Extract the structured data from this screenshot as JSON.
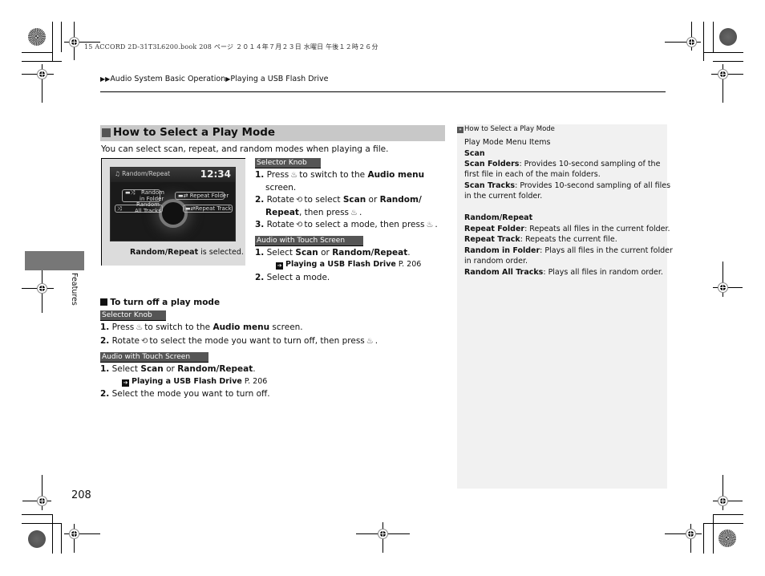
{
  "print_header": "15 ACCORD 2D-31T3L6200.book  208 ページ  ２０１４年７月２３日  水曜日  午後１２時２６分",
  "breadcrumb": {
    "prefix_icon": "double-triangle-right",
    "items": [
      "Audio System Basic Operation",
      "Playing a USB Flash Drive"
    ]
  },
  "section": {
    "title": "How to Select a Play Mode",
    "intro": "You can select scan, repeat, and random modes when playing a file."
  },
  "figure": {
    "screen_title": "Random/Repeat",
    "clock": "12:34",
    "options": [
      "Random in Folder",
      "Repeat Folder",
      "Random All Tracks",
      "Repeat Track"
    ],
    "option_lines": {
      "random_in_folder_1": "Random",
      "random_in_folder_2": "in Folder",
      "repeat_folder": "Repeat Folder",
      "random_all_1": "Random",
      "random_all_2": "All Tracks",
      "repeat_track": "Repeat Track"
    },
    "caption_bold": "Random/Repeat",
    "caption_rest": " is selected."
  },
  "select_mode": {
    "selector_knob_label": "Selector Knob",
    "knob_steps": [
      {
        "num": "1.",
        "pre": "Press",
        "icon": "press-knob",
        "text": "to switch to the",
        "bold": "Audio menu",
        "post": "screen."
      },
      {
        "num": "2.",
        "pre": "Rotate",
        "icon": "rotate-knob",
        "text": "to select",
        "bold1": "Scan",
        "mid": "or",
        "bold2": "Random/",
        "bold3": "Repeat",
        "post": ", then press"
      },
      {
        "num": "3.",
        "pre": "Rotate",
        "icon": "rotate-knob",
        "text": "to select a mode, then press"
      }
    ],
    "touch_label": "Audio with Touch Screen",
    "touch_steps": [
      {
        "num": "1.",
        "pre": "Select",
        "bold1": "Scan",
        "mid": "or",
        "bold2": "Random/Repeat",
        "post": "."
      },
      {
        "num": "2.",
        "text": "Select a mode."
      }
    ],
    "ref": {
      "title": "Playing a USB Flash Drive",
      "page": "P. 206"
    }
  },
  "turn_off": {
    "heading": "To turn off a play mode",
    "selector_knob_label": "Selector Knob",
    "knob_steps": [
      {
        "num": "1.",
        "pre": "Press",
        "text": "to switch to the",
        "bold": "Audio menu",
        "post": "screen."
      },
      {
        "num": "2.",
        "pre": "Rotate",
        "text": "to select the mode you want to turn off, then press"
      }
    ],
    "touch_label": "Audio with Touch Screen",
    "touch_steps": [
      {
        "num": "1.",
        "pre": "Select",
        "bold1": "Scan",
        "mid": "or",
        "bold2": "Random/Repeat",
        "post": "."
      },
      {
        "num": "2.",
        "text": "Select the mode you want to turn off."
      }
    ],
    "ref": {
      "title": "Playing a USB Flash Drive",
      "page": "P. 206"
    }
  },
  "sidebar": {
    "ref_title": "How to Select a Play Mode",
    "heading": "Play Mode Menu Items",
    "scan_heading": "Scan",
    "scan_folders_label": "Scan Folders",
    "scan_folders_text_1": ": Provides 10-second sampling of the",
    "scan_folders_text_2": "first file in each of the main folders.",
    "scan_tracks_label": "Scan Tracks",
    "scan_tracks_text_1": ": Provides 10-second sampling of all files",
    "scan_tracks_text_2": "in the current folder.",
    "random_heading": "Random/Repeat",
    "repeat_folder_label": "Repeat Folder",
    "repeat_folder_text": ": Repeats all files in the current folder.",
    "repeat_track_label": "Repeat Track",
    "repeat_track_text": ": Repeats the current file.",
    "random_folder_label": "Random in Folder",
    "random_folder_text_1": ": Plays all files in the current folder",
    "random_folder_text_2": "in random order.",
    "random_all_label": "Random All Tracks",
    "random_all_text": ": Plays all files in random order."
  },
  "side_tab": "Features",
  "page_number": "208"
}
